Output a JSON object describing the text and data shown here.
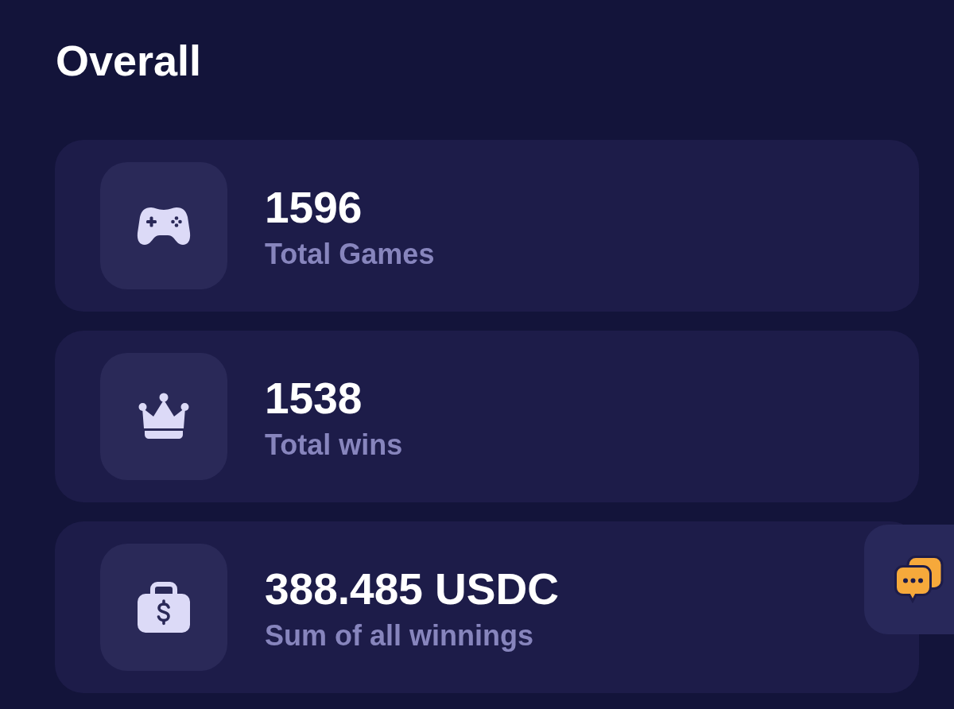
{
  "title": "Overall",
  "stats": [
    {
      "kind": "games",
      "value": "1596",
      "label": "Total Games"
    },
    {
      "kind": "wins",
      "value": "1538",
      "label": "Total wins"
    },
    {
      "kind": "winnings",
      "value": "388.485 USDC",
      "label": "Sum of all winnings"
    }
  ]
}
